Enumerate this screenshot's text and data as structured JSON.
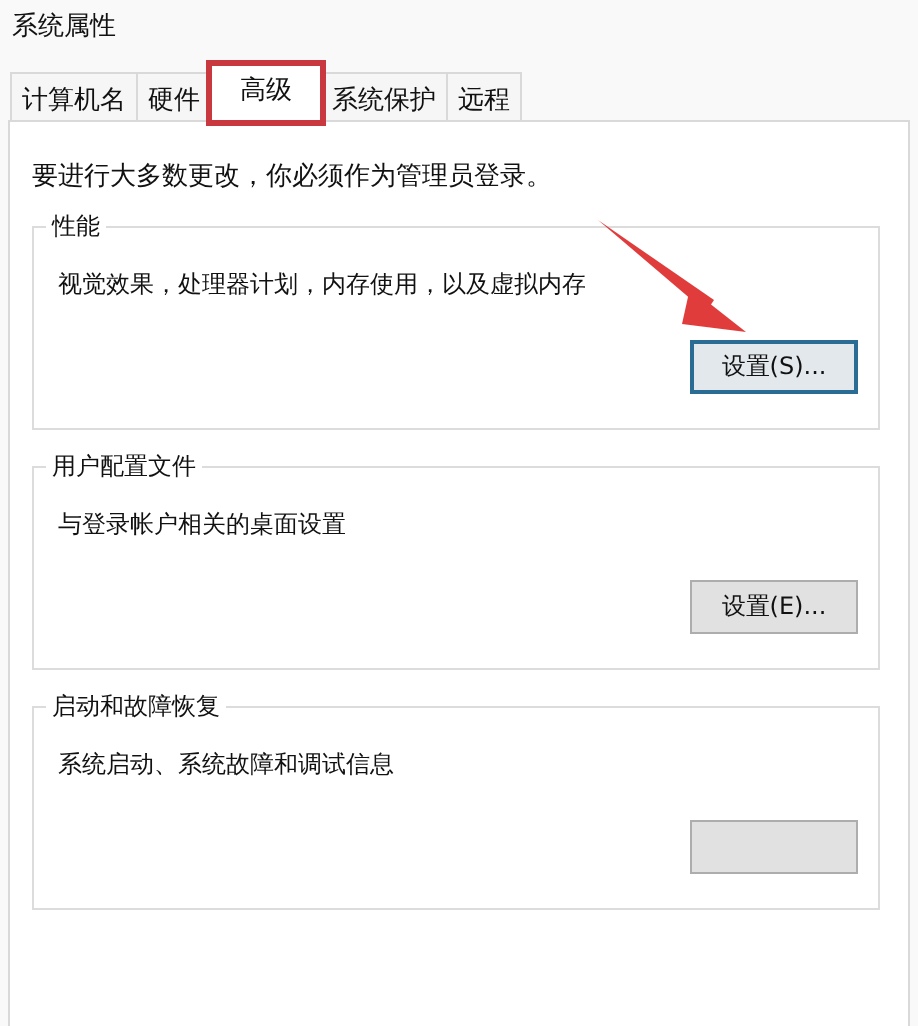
{
  "window": {
    "title": "系统属性"
  },
  "tabs": [
    {
      "label": "计算机名",
      "selected": false,
      "highlighted": false
    },
    {
      "label": "硬件",
      "selected": false,
      "highlighted": false
    },
    {
      "label": "高级",
      "selected": true,
      "highlighted": true
    },
    {
      "label": "系统保护",
      "selected": false,
      "highlighted": false
    },
    {
      "label": "远程",
      "selected": false,
      "highlighted": false
    }
  ],
  "notice": "要进行大多数更改，你必须作为管理员登录。",
  "groups": [
    {
      "title": "性能",
      "description": "视觉效果，处理器计划，内存使用，以及虚拟内存",
      "button": "设置(S)...",
      "focused": true,
      "pointed_by_arrow": true
    },
    {
      "title": "用户配置文件",
      "description": "与登录帐户相关的桌面设置",
      "button": "设置(E)...",
      "focused": false,
      "pointed_by_arrow": false
    },
    {
      "title": "启动和故障恢复",
      "description": "系统启动、系统故障和调试信息",
      "focused": false,
      "pointed_by_arrow": false
    }
  ]
}
